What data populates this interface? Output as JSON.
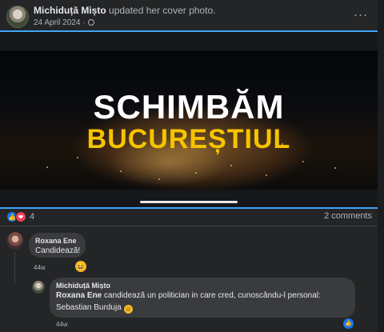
{
  "post": {
    "author": "Michiduță Mișto",
    "action": "updated her cover photo.",
    "date": "24 April 2024 ·",
    "more": "···"
  },
  "cover": {
    "line1": "SCHIMBĂM",
    "line2": "BUCUREȘTIUL"
  },
  "reactions": {
    "count": "4",
    "comments": "2 comments",
    "like_symbol": "👍",
    "love_symbol": "❤"
  },
  "comments": [
    {
      "author": "Roxana Ene",
      "text": "Candidează!",
      "time": "44w",
      "reaction": "😆"
    },
    {
      "author": "Michiduță Mișto",
      "mention": "Roxana Ene",
      "text": "candidează un politician in care cred, cunoscându-l personal:",
      "text2": "Sebastian Burduja",
      "emoji": "☺",
      "time": "44w",
      "like": "👍"
    }
  ]
}
